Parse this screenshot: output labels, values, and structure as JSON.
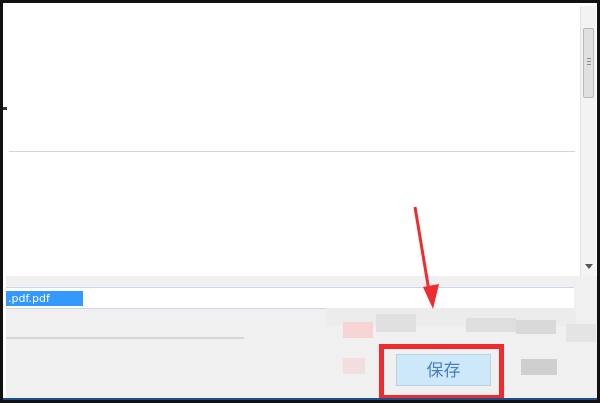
{
  "file_dialog": {
    "filename_value": ".pdf.pdf",
    "save_label": "保存"
  },
  "colors": {
    "highlight": "#ee2b2f",
    "selection": "#3399ff",
    "save_button_bg": "#cde8f8",
    "save_button_text": "#4a7fc1"
  },
  "icons": {
    "annotation": "arrow-down-icon",
    "scroll_down": "chevron-down-icon"
  }
}
